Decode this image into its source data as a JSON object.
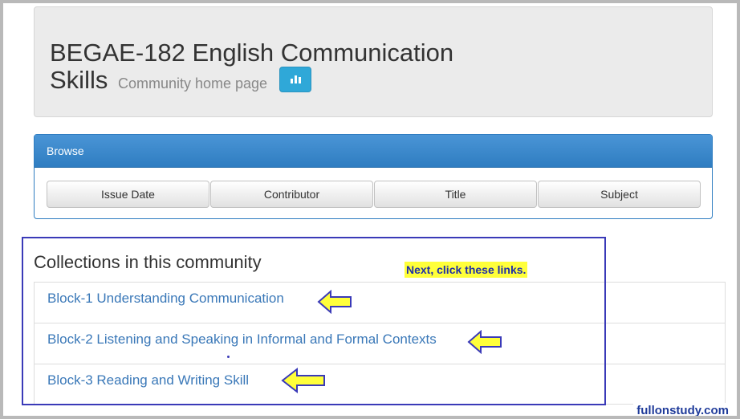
{
  "header": {
    "title_line1": "BEGAE-182 English Communication",
    "title_line2": "Skills",
    "subtitle": "Community home page",
    "stats_icon": "bar-chart-icon"
  },
  "browse": {
    "heading": "Browse",
    "buttons": [
      "Issue Date",
      "Contributor",
      "Title",
      "Subject"
    ]
  },
  "collections": {
    "heading": "Collections in this community",
    "items": [
      "Block-1 Understanding Communication",
      "Block-2 Listening and Speaking in Informal and Formal Contexts",
      "Block-3 Reading and Writing Skill"
    ]
  },
  "annotation": {
    "note": "Next, click these links.",
    "arrow_icon": "yellow-left-arrow-icon",
    "highlight_color": "#ffff3a",
    "box_color": "#3a3ab8"
  },
  "watermark": "fullonstudy.com"
}
